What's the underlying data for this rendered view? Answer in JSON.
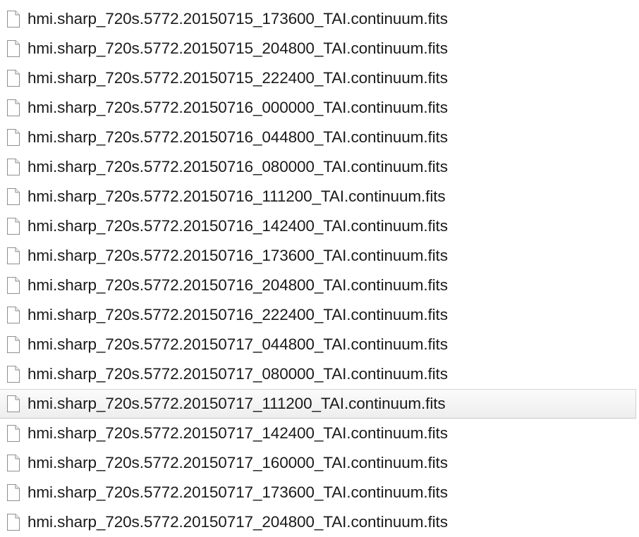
{
  "file_list": {
    "icon": "generic-file-icon",
    "hover_color": "#eeeeee",
    "items": [
      {
        "name": "hmi.sharp_720s.5772.20150715_173600_TAI.continuum.fits",
        "highlighted": false
      },
      {
        "name": "hmi.sharp_720s.5772.20150715_204800_TAI.continuum.fits",
        "highlighted": false
      },
      {
        "name": "hmi.sharp_720s.5772.20150715_222400_TAI.continuum.fits",
        "highlighted": false
      },
      {
        "name": "hmi.sharp_720s.5772.20150716_000000_TAI.continuum.fits",
        "highlighted": false
      },
      {
        "name": "hmi.sharp_720s.5772.20150716_044800_TAI.continuum.fits",
        "highlighted": false
      },
      {
        "name": "hmi.sharp_720s.5772.20150716_080000_TAI.continuum.fits",
        "highlighted": false
      },
      {
        "name": "hmi.sharp_720s.5772.20150716_111200_TAI.continuum.fits",
        "highlighted": false
      },
      {
        "name": "hmi.sharp_720s.5772.20150716_142400_TAI.continuum.fits",
        "highlighted": false
      },
      {
        "name": "hmi.sharp_720s.5772.20150716_173600_TAI.continuum.fits",
        "highlighted": false
      },
      {
        "name": "hmi.sharp_720s.5772.20150716_204800_TAI.continuum.fits",
        "highlighted": false
      },
      {
        "name": "hmi.sharp_720s.5772.20150716_222400_TAI.continuum.fits",
        "highlighted": false
      },
      {
        "name": "hmi.sharp_720s.5772.20150717_044800_TAI.continuum.fits",
        "highlighted": false
      },
      {
        "name": "hmi.sharp_720s.5772.20150717_080000_TAI.continuum.fits",
        "highlighted": false
      },
      {
        "name": "hmi.sharp_720s.5772.20150717_111200_TAI.continuum.fits",
        "highlighted": true
      },
      {
        "name": "hmi.sharp_720s.5772.20150717_142400_TAI.continuum.fits",
        "highlighted": false
      },
      {
        "name": "hmi.sharp_720s.5772.20150717_160000_TAI.continuum.fits",
        "highlighted": false
      },
      {
        "name": "hmi.sharp_720s.5772.20150717_173600_TAI.continuum.fits",
        "highlighted": false
      },
      {
        "name": "hmi.sharp_720s.5772.20150717_204800_TAI.continuum.fits",
        "highlighted": false
      }
    ]
  }
}
